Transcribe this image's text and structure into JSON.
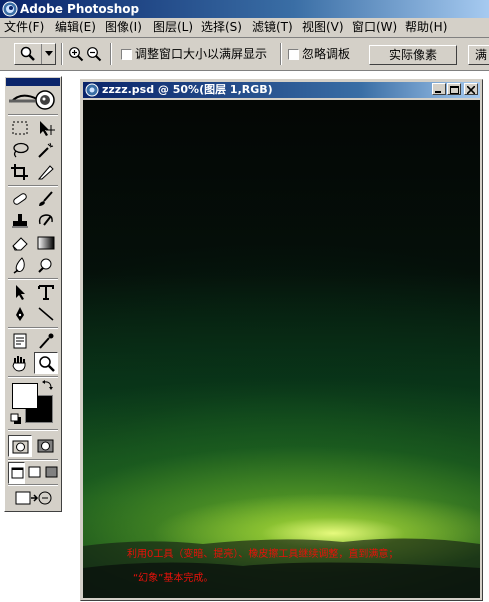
{
  "app": {
    "title": "Adobe Photoshop"
  },
  "menu": [
    {
      "label": "文件(F)"
    },
    {
      "label": "编辑(E)"
    },
    {
      "label": "图像(I)"
    },
    {
      "label": "图层(L)"
    },
    {
      "label": "选择(S)"
    },
    {
      "label": "滤镜(T)"
    },
    {
      "label": "视图(V)"
    },
    {
      "label": "窗口(W)"
    },
    {
      "label": "帮助(H)"
    }
  ],
  "options": {
    "resize_windows_label": "调整窗口大小以满屏显示",
    "resize_windows_checked": false,
    "ignore_palettes_label": "忽略调板",
    "ignore_palettes_checked": false,
    "actual_pixels_label": "实际像素",
    "next_button_label": "满"
  },
  "colors": {
    "foreground": "#ffffff",
    "background": "#000000",
    "caption": "#e8110a",
    "titlebar_active": "#0a246a"
  },
  "toolbox": {
    "active_tool": "zoom-tool",
    "tools": [
      "marquee-icon",
      "move-icon",
      "lasso-icon",
      "magic-wand-icon",
      "crop-icon",
      "slice-icon",
      "healing-brush-icon",
      "brush-icon",
      "clone-stamp-icon",
      "history-brush-icon",
      "eraser-icon",
      "gradient-icon",
      "blur-icon",
      "dodge-icon",
      "path-selection-icon",
      "type-icon",
      "pen-icon",
      "line-shape-icon",
      "notes-icon",
      "eyedropper-icon",
      "hand-icon",
      "zoom-icon"
    ]
  },
  "document": {
    "title": "zzzz.psd @ 50%(图层 1,RGB)",
    "caption_line1": "利用0工具（变暗、提亮）、橡皮擦工具继续调整，直到满意；",
    "caption_line2": "“幻象”基本完成。"
  }
}
